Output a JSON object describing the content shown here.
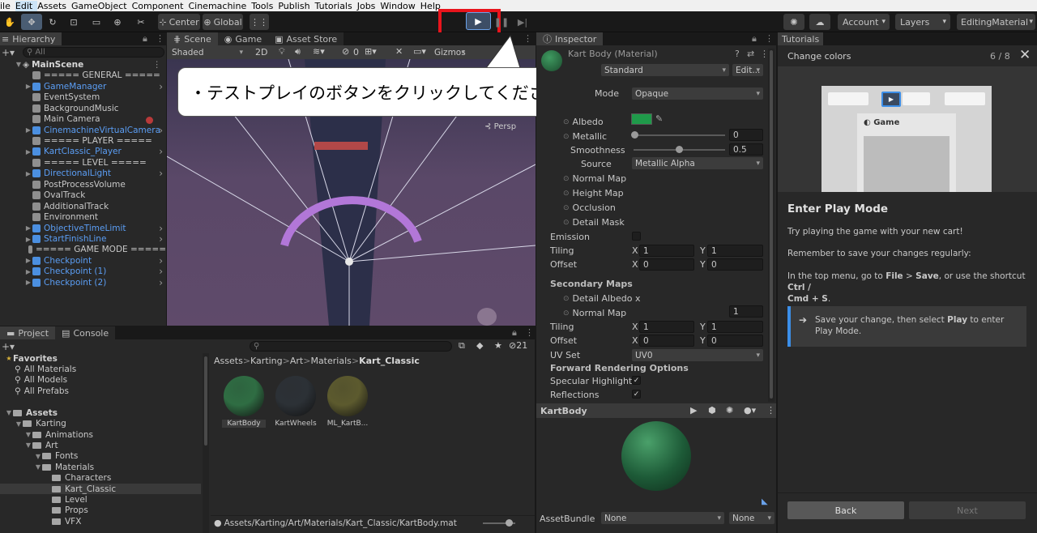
{
  "menu": [
    "ile",
    "Edit",
    "Assets",
    "GameObject",
    "Component",
    "Cinemachine",
    "Tools",
    "Publish",
    "Tutorials",
    "Jobs",
    "Window",
    "Help"
  ],
  "toolbar": {
    "pivot_center": "Center",
    "pivot_global": "Global",
    "account": "Account",
    "layers": "Layers",
    "layout": "EditingMaterial"
  },
  "hierarchy": {
    "tab": "Hierarchy",
    "search_placeholder": "All",
    "scene": "MainScene",
    "items": [
      {
        "label": "===== GENERAL =====",
        "prefab": false,
        "arrow": false
      },
      {
        "label": "GameManager",
        "prefab": true,
        "arrow": true
      },
      {
        "label": "EventSystem",
        "prefab": false,
        "arrow": false
      },
      {
        "label": "BackgroundMusic",
        "prefab": false,
        "arrow": false
      },
      {
        "label": "Main Camera",
        "prefab": false,
        "arrow": false
      },
      {
        "label": "CinemachineVirtualCamera",
        "prefab": true,
        "arrow": true
      },
      {
        "label": "===== PLAYER =====",
        "prefab": false,
        "arrow": false
      },
      {
        "label": "KartClassic_Player",
        "prefab": true,
        "arrow": true
      },
      {
        "label": "===== LEVEL =====",
        "prefab": false,
        "arrow": false
      },
      {
        "label": "DirectionalLight",
        "prefab": true,
        "arrow": true
      },
      {
        "label": "PostProcessVolume",
        "prefab": false,
        "arrow": false
      },
      {
        "label": "OvalTrack",
        "prefab": false,
        "arrow": false
      },
      {
        "label": "AdditionalTrack",
        "prefab": false,
        "arrow": false
      },
      {
        "label": "Environment",
        "prefab": false,
        "arrow": false
      },
      {
        "label": "ObjectiveTimeLimit",
        "prefab": true,
        "arrow": true
      },
      {
        "label": "StartFinishLine",
        "prefab": true,
        "arrow": true
      },
      {
        "label": "===== GAME MODE =====",
        "prefab": false,
        "arrow": false
      },
      {
        "label": "Checkpoint",
        "prefab": true,
        "arrow": true
      },
      {
        "label": "Checkpoint (1)",
        "prefab": true,
        "arrow": true
      },
      {
        "label": "Checkpoint (2)",
        "prefab": true,
        "arrow": true
      }
    ]
  },
  "scene": {
    "tabs": [
      "Scene",
      "Game",
      "Asset Store"
    ],
    "shading": "Shaded",
    "mode2d": "2D",
    "fx_count": "0",
    "gizmos": "Gizmos",
    "persp": "Persp"
  },
  "callout": "・テストプレイのボタンをクリックしてください",
  "project": {
    "tabs": [
      "Project",
      "Console"
    ],
    "hidden_count": "21",
    "favorites_title": "Favorites",
    "favorites": [
      "All Materials",
      "All Models",
      "All Prefabs"
    ],
    "assets_title": "Assets",
    "tree": [
      {
        "label": "Karting",
        "indent": 1
      },
      {
        "label": "Animations",
        "indent": 2
      },
      {
        "label": "Art",
        "indent": 2
      },
      {
        "label": "Fonts",
        "indent": 3
      },
      {
        "label": "Materials",
        "indent": 3
      },
      {
        "label": "Characters",
        "indent": 4
      },
      {
        "label": "Kart_Classic",
        "indent": 4,
        "selected": true
      },
      {
        "label": "Level",
        "indent": 4
      },
      {
        "label": "Props",
        "indent": 4
      },
      {
        "label": "VFX",
        "indent": 4
      }
    ],
    "breadcrumb": [
      "Assets",
      "Karting",
      "Art",
      "Materials",
      "Kart_Classic"
    ],
    "assets": [
      {
        "label": "KartBody",
        "color": "#2f6d43"
      },
      {
        "label": "KartWheels",
        "color": "#2c3136"
      },
      {
        "label": "ML_KartB...",
        "color": "#5c5a2e"
      }
    ],
    "path": "Assets/Karting/Art/Materials/Kart_Classic/KartBody.mat"
  },
  "inspector": {
    "tab": "Inspector",
    "title": "Kart Body (Material)",
    "shader": "Standard",
    "edit": "Edit...",
    "render_mode_label": "Mode",
    "render_mode": "Opaque",
    "albedo": "Albedo",
    "albedo_color": "#1f9a4a",
    "metallic": "Metallic",
    "metallic_value": "0",
    "smoothness": "Smoothness",
    "smoothness_value": "0.5",
    "source": "Source",
    "source_value": "Metallic Alpha",
    "normal_map": "Normal Map",
    "height_map": "Height Map",
    "occlusion": "Occlusion",
    "detail_mask": "Detail Mask",
    "emission": "Emission",
    "tiling": "Tiling",
    "offset": "Offset",
    "tiling_x": "1",
    "tiling_y": "1",
    "offset_x": "0",
    "offset_y": "0",
    "secondary_maps": "Secondary Maps",
    "detail_albedo": "Detail Albedo x",
    "normal_map2": "Normal Map",
    "normal_map2_value": "1",
    "tiling2": "Tiling",
    "offset2": "Offset",
    "tiling2_x": "1",
    "tiling2_y": "1",
    "offset2_x": "0",
    "offset2_y": "0",
    "uv_set": "UV Set",
    "uv_set_value": "UV0",
    "forward_options": "Forward Rendering Options",
    "specular": "Specular Highlights",
    "reflections": "Reflections",
    "preview_title": "KartBody",
    "asset_bundle": "AssetBundle",
    "bundle_none": "None",
    "variant_none": "None",
    "x": "X",
    "y": "Y"
  },
  "tutorials": {
    "tab": "Tutorials",
    "header": "Change colors",
    "progress": "6 / 8",
    "preview_game": "Game",
    "title": "Enter Play Mode",
    "p1": "Try playing the game with your new cart!",
    "p2": "Remember to save your changes regularly:",
    "p3_a": "In the top menu, go to ",
    "p3_b": "File",
    "p3_c": " > ",
    "p3_d": "Save",
    "p3_e": ", or use the shortcut ",
    "p3_f": "Ctrl /",
    "p3_g": "Cmd + S",
    "p3_h": ".",
    "instr_a": "Save your change, then select ",
    "instr_b": "Play",
    "instr_c": " to enter Play Mode.",
    "back": "Back",
    "next": "Next"
  },
  "colors": {
    "highlight_red": "#e8141c",
    "accent_blue": "#3b8ee8"
  }
}
